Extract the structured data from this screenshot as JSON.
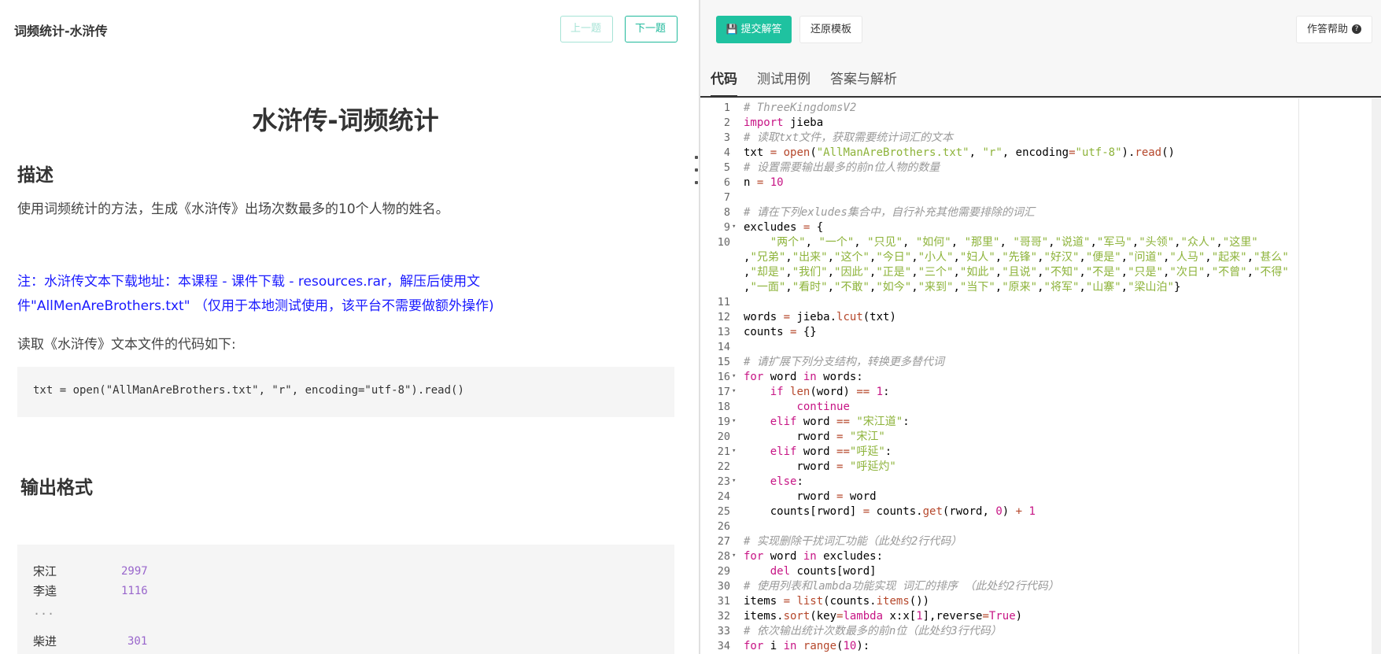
{
  "left": {
    "header_title": "词频统计-水浒传",
    "prev_label": "上一题",
    "next_label": "下一题",
    "title": "水浒传-词频统计",
    "desc_heading": "描述",
    "desc_text": "使用词频统计的方法，生成《水浒传》出场次数最多的10个人物的姓名。",
    "note_text": "注：水浒传文本下载地址：本课程 - 课件下载 - resources.rar，解压后使用文件\"AllMenAreBrothers.txt\" （仅用于本地测试使用，该平台不需要做额外操作)",
    "read_text": "读取《水浒传》文本文件的代码如下:",
    "code_line": "txt = open(\"AllManAreBrothers.txt\", \"r\", encoding=\"utf-8\").read()",
    "output_heading": "输出格式",
    "output_rows": [
      {
        "name": "宋江",
        "count": "2997"
      },
      {
        "name": "李逵",
        "count": "1116"
      },
      {
        "name": "...",
        "count": ""
      },
      {
        "name": "柴进",
        "count": "301"
      }
    ]
  },
  "right": {
    "submit_label": "提交解答",
    "reset_label": "还原模板",
    "help_label": "作答帮助",
    "tabs": [
      "代码",
      "测试用例",
      "答案与解析"
    ],
    "code_lines": [
      "# ThreeKingdomsV2",
      "import jieba",
      "# 读取txt文件，获取需要统计词汇的文本",
      "txt = open(\"AllManAreBrothers.txt\", \"r\", encoding=\"utf-8\").read()",
      "# 设置需要输出最多的前n位人物的数量",
      "n = 10",
      "",
      "# 请在下列exludes集合中，自行补充其他需要排除的词汇",
      "excludes = {",
      "    \"两个\", \"一个\", \"只见\", \"如何\", \"那里\", \"哥哥\",\"说道\",\"军马\",\"头领\",\"众人\",\"这里\"",
      ",\"兄弟\",\"出来\",\"这个\",\"今日\",\"小人\",\"妇人\",\"先锋\",\"好汉\",\"便是\",\"问道\",\"人马\",\"起来\",\"甚么\"",
      ",\"却是\",\"我们\",\"因此\",\"正是\",\"三个\",\"如此\",\"且说\",\"不知\",\"不是\",\"只是\",\"次日\",\"不曾\",\"不得\"",
      ",\"一面\",\"看时\",\"不敢\",\"如今\",\"来到\",\"当下\",\"原来\",\"将军\",\"山寨\",\"梁山泊\"}",
      "",
      "words = jieba.lcut(txt)",
      "counts = {}",
      "",
      "# 请扩展下列分支结构，转换更多替代词",
      "for word in words:",
      "    if len(word) == 1:",
      "        continue",
      "    elif word == \"宋江道\":",
      "        rword = \"宋江\"",
      "    elif word ==\"呼延\":",
      "        rword = \"呼延灼\"",
      "    else:",
      "        rword = word",
      "    counts[rword] = counts.get(rword, 0) + 1",
      "    ",
      "# 实现删除干扰词汇功能（此处约2行代码）    ",
      "for word in excludes:",
      "    del counts[word]",
      "# 使用列表和lambda功能实现 词汇的排序 （此处约2行代码）    ",
      "items = list(counts.items())",
      "items.sort(key=lambda x:x[1],reverse=True)",
      "# 依次输出统计次数最多的前n位（此处约3行代码）  ",
      "for i in range(10):"
    ],
    "line_numbers": [
      "1",
      "2",
      "3",
      "4",
      "5",
      "6",
      "7",
      "8",
      "9",
      "10",
      "",
      "",
      "",
      "11",
      "12",
      "13",
      "14",
      "15",
      "16",
      "17",
      "18",
      "19",
      "20",
      "21",
      "22",
      "23",
      "24",
      "25",
      "26",
      "27",
      "28",
      "29",
      "30",
      "31",
      "32",
      "33",
      "34"
    ]
  },
  "colors": {
    "accent": "#1fc2a0",
    "note_blue": "#1a1aff",
    "comment": "#999999",
    "keyword": "#c71585",
    "string": "#8db33a"
  }
}
